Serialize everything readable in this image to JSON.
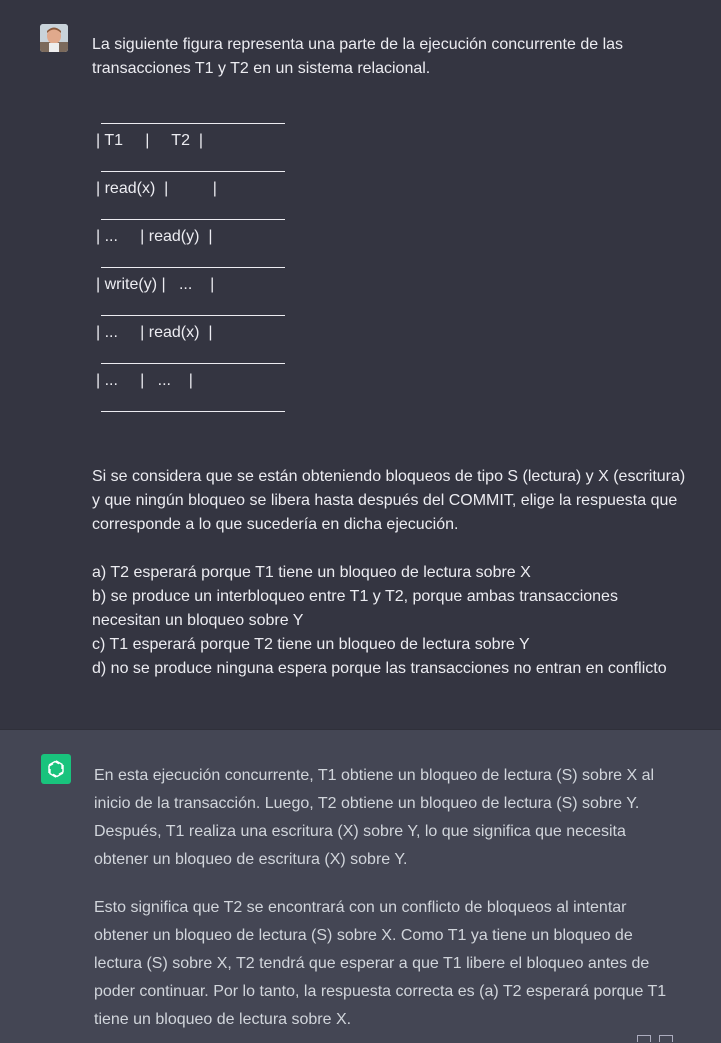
{
  "user_message": {
    "intro": "La siguiente figura representa una parte de la ejecución concurrente de las transacciones T1 y T2 en un sistema relacional.",
    "table_lines": [
      "| T1     |     T2  |",
      "| read(x)  |          |",
      "| ...     | read(y)  |",
      "| write(y) |   ...    |",
      "| ...     | read(x)  |",
      "| ...     |   ...    |"
    ],
    "question": "Si se considera que se están obteniendo bloqueos de tipo S (lectura) y X (escritura) y que ningún bloqueo se libera hasta después del COMMIT, elige la respuesta que corresponde a lo que sucedería en dicha ejecución.",
    "options": [
      "a) T2 esperará porque T1 tiene un bloqueo de lectura sobre X",
      "b) se produce un interbloqueo entre T1 y T2, porque ambas transacciones",
      "necesitan un bloqueo sobre Y",
      "c) T1 esperará porque T2 tiene un bloqueo de lectura sobre Y",
      "d) no se produce ninguna espera porque las transacciones no entran en conflicto"
    ]
  },
  "assistant_message": {
    "paragraph1": "En esta ejecución concurrente, T1 obtiene un bloqueo de lectura (S) sobre X al inicio de la transacción. Luego, T2 obtiene un bloqueo de lectura (S) sobre Y. Después, T1 realiza una escritura (X) sobre Y, lo que significa que necesita obtener un bloqueo de escritura (X) sobre Y.",
    "paragraph2": "Esto significa que T2 se encontrará con un conflicto de bloqueos al intentar obtener un bloqueo de lectura (S) sobre X. Como T1 ya tiene un bloqueo de lectura (S) sobre X, T2 tendrá que esperar a que T1 libere el bloqueo antes de poder continuar. Por lo tanto, la respuesta correcta es (a) T2 esperará porque T1 tiene un bloqueo de lectura sobre X."
  },
  "icons": {
    "user_avatar": "user-avatar-icon",
    "assistant_avatar": "openai-logo-icon",
    "action_icons": [
      "thumbs-up-icon",
      "copy-icon"
    ]
  },
  "colors": {
    "user_bg": "#343541",
    "assistant_bg": "#444654",
    "gpt_green": "#19c37d"
  }
}
